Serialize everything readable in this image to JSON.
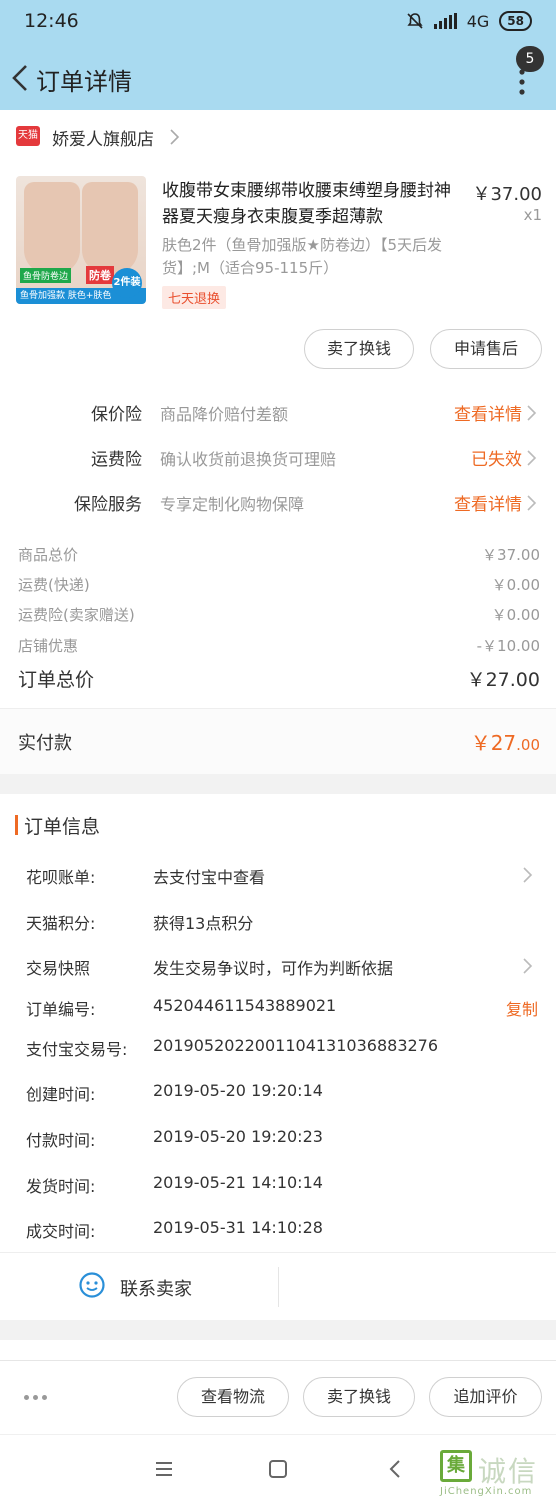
{
  "status_bar": {
    "time": "12:46",
    "network": "4G",
    "battery": "58"
  },
  "nav": {
    "title": "订单详情",
    "badge_count": "5"
  },
  "shop": {
    "logo_text": "天猫",
    "name": "娇爱人旗舰店"
  },
  "product": {
    "title": "收腹带女束腰绑带收腰束缚塑身腰封神器夏天瘦身衣束腹夏季超薄款",
    "price": "￥37.00",
    "quantity": "x1",
    "sku": "肤色2件（鱼骨加强版★防卷边）【5天后发货】;M（适合95-115斤）",
    "return_tag": "七天退换",
    "image_labels": {
      "green": "鱼骨防卷边",
      "red": "防卷",
      "bottom": "鱼骨加强款 肤色+肤色",
      "circle": "2件装"
    }
  },
  "item_actions": {
    "sell": "卖了换钱",
    "after_sale": "申请售后"
  },
  "insurance": [
    {
      "label": "保价险",
      "desc": "商品降价赔付差额",
      "action": "查看详情"
    },
    {
      "label": "运费险",
      "desc": "确认收货前退换货可理赔",
      "action": "已失效"
    },
    {
      "label": "保险服务",
      "desc": "专享定制化购物保障",
      "action": "查看详情"
    }
  ],
  "price_breakdown": [
    {
      "label": "商品总价",
      "value": "￥37.00"
    },
    {
      "label": "运费(快递)",
      "value": "￥0.00"
    },
    {
      "label": "运费险(卖家赠送)",
      "value": "￥0.00"
    },
    {
      "label": "店铺优惠",
      "value": "-￥10.00"
    }
  ],
  "order_total": {
    "label": "订单总价",
    "value": "￥27.00"
  },
  "paid": {
    "label": "实付款",
    "currency": "￥",
    "integer": "27",
    "decimal": ".00"
  },
  "order_info": {
    "title": "订单信息",
    "rows": [
      {
        "key": "花呗账单:",
        "value": "去支付宝中查看"
      },
      {
        "key": "天猫积分:",
        "value": "获得13点积分"
      },
      {
        "key": "交易快照",
        "value": "发生交易争议时，可作为判断依据"
      },
      {
        "key": "订单编号:",
        "value": "452044611543889021"
      },
      {
        "key": "支付宝交易号:",
        "value": "2019052022001104131036883276"
      },
      {
        "key": "创建时间:",
        "value": "2019-05-20 19:20:14"
      },
      {
        "key": "付款时间:",
        "value": "2019-05-20 19:20:23"
      },
      {
        "key": "发货时间:",
        "value": "2019-05-21 14:10:14"
      },
      {
        "key": "成交时间:",
        "value": "2019-05-31 14:10:28"
      }
    ],
    "copy_label": "复制"
  },
  "contact": {
    "label": "联系卖家"
  },
  "bottom_actions": {
    "logistics": "查看物流",
    "sell": "卖了换钱",
    "review": "追加评价"
  },
  "watermark": {
    "chars": "诚信",
    "box": "集",
    "sub": "JiChengXin.com"
  },
  "colors": {
    "header_bg": "#a9daf0",
    "accent": "#ee6a24",
    "tmall_red": "#e4393c"
  }
}
